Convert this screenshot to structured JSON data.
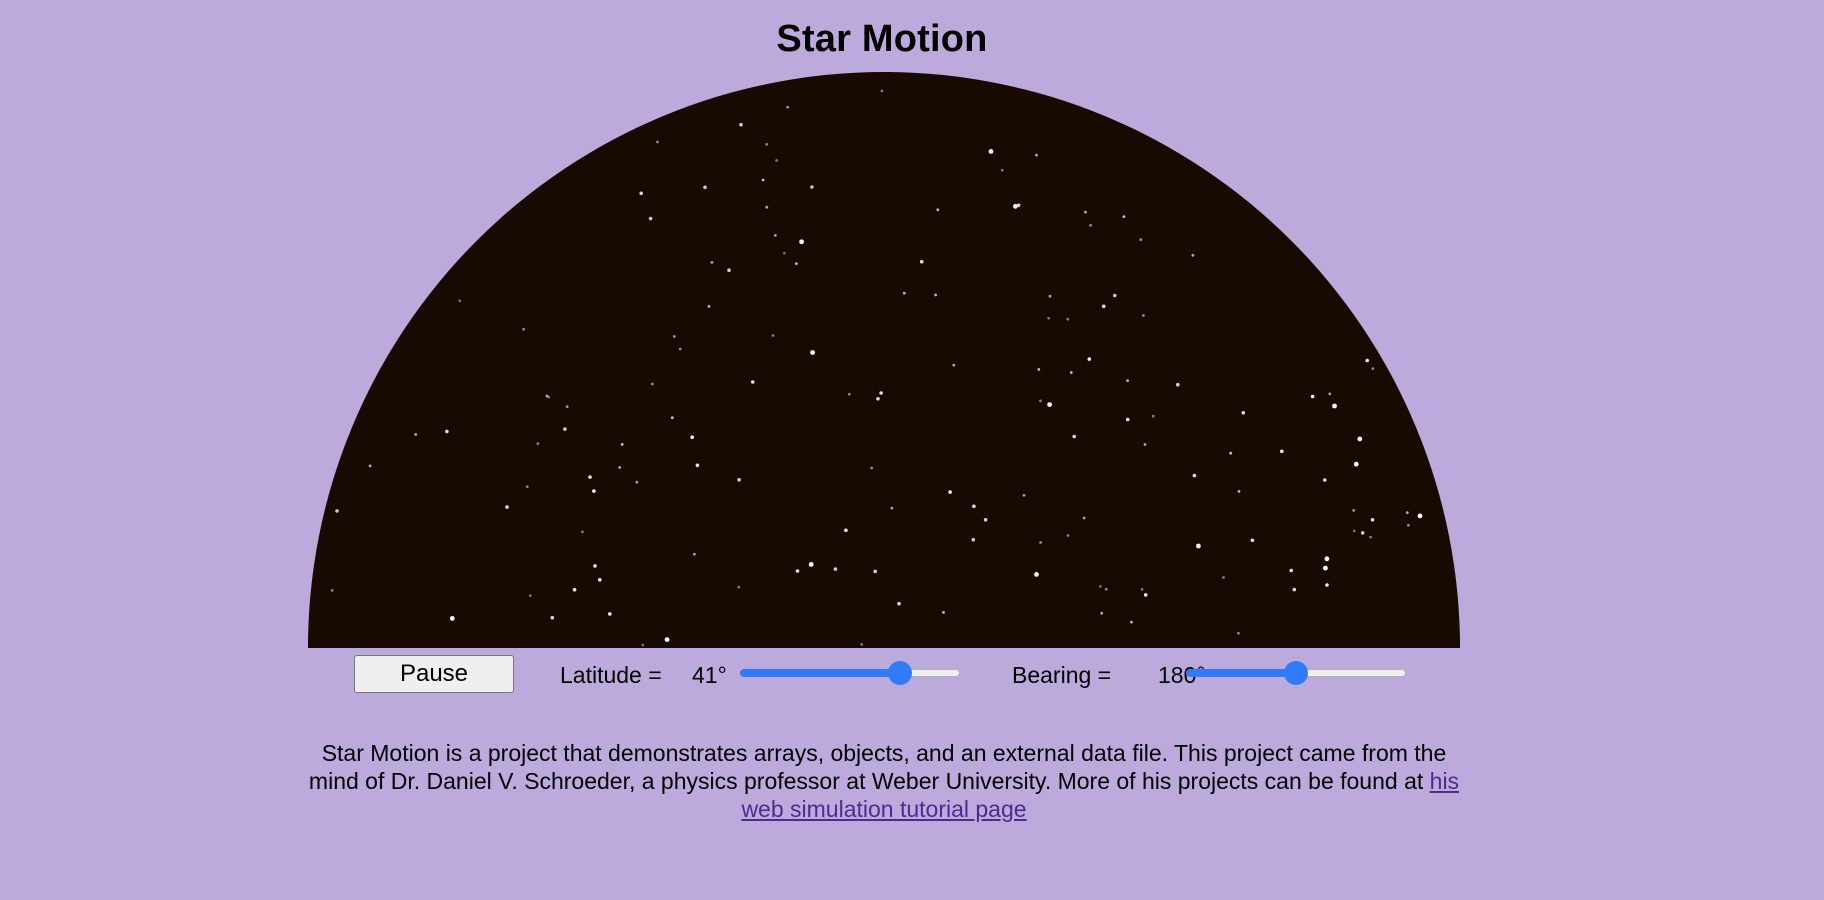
{
  "title": "Star Motion",
  "controls": {
    "pause_label": "Pause",
    "latitude": {
      "label": "Latitude =",
      "value_text": "41°",
      "value": 41,
      "min": -90,
      "max": 90
    },
    "bearing": {
      "label": "Bearing =",
      "value_text": "180°",
      "value": 180,
      "min": 0,
      "max": 360
    },
    "slider_color": "#2f7cf6"
  },
  "description": {
    "text": "Star Motion is a project that demonstrates arrays, objects, and an external data file. This project came from the mind of Dr. Daniel V. Schroeder, a physics professor at Weber University. More of his projects can be found at ",
    "link_text": "his web simulation tutorial page"
  },
  "colors": {
    "background": "#bbaadb",
    "sky": "#180902",
    "link": "#4f2a8f"
  }
}
